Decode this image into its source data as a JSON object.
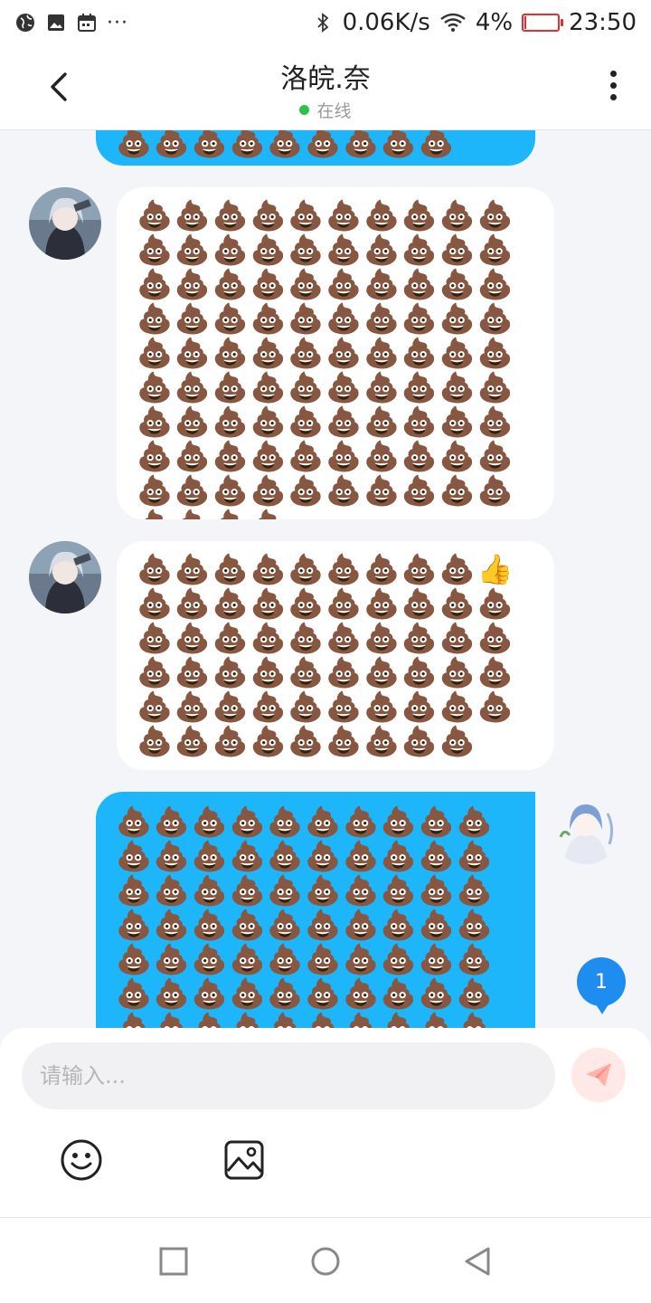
{
  "status_bar": {
    "left_icons": [
      "globe-icon",
      "image-icon",
      "calendar-icon"
    ],
    "more": "···",
    "net_speed": "0.06K/s",
    "battery": "4%",
    "time": "23:50",
    "battery_color": "#e0302e"
  },
  "header": {
    "title": "洛皖.奈",
    "status": "在线",
    "status_color": "#2bc24a"
  },
  "messages": [
    {
      "side": "out",
      "text": "💩💩💩💩💩💩💩💩💩"
    },
    {
      "side": "in",
      "text": "💩💩💩💩💩💩💩💩💩💩💩💩💩💩💩💩💩💩💩💩💩💩💩💩💩💩💩💩💩💩💩💩💩💩💩💩💩💩💩💩💩💩💩💩💩💩💩💩💩💩💩💩💩💩💩💩💩💩💩💩💩💩💩💩💩💩💩💩💩💩💩💩💩💩💩💩💩💩💩💩💩💩💩💩💩💩💩💩💩💩💩💩💩💩"
    },
    {
      "side": "in",
      "text": "💩💩💩💩💩💩💩💩💩👍💩💩💩💩💩💩💩💩💩💩💩💩💩💩💩💩💩💩💩💩💩💩💩💩💩💩💩💩💩💩💩💩💩💩💩💩💩💩💩💩💩💩💩💩💩💩💩💩💩"
    },
    {
      "side": "out",
      "text": "💩💩💩💩💩💩💩💩💩💩💩💩💩💩💩💩💩💩💩💩💩💩💩💩💩💩💩💩💩💩💩💩💩💩💩💩💩💩💩💩💩💩💩💩💩💩💩💩💩💩💩💩💩💩💩💩💩💩💩💩💩💩💩💩💩💩💩💩💩💩💩💩💩💩💩💩💩"
    }
  ],
  "unread_badge": "1",
  "input": {
    "placeholder": "请输入..."
  },
  "colors": {
    "outgoing_bubble": "#1db6fa",
    "incoming_bubble": "#ffffff",
    "send_button_bg": "#ffe9e6",
    "send_icon": "#ff8a80",
    "badge": "#1f8cf0"
  },
  "toolbar": {
    "emoji": "smiley-face-icon",
    "image": "image-icon"
  },
  "nav": {
    "recents": "square-icon",
    "home": "circle-icon",
    "back": "triangle-back-icon"
  }
}
